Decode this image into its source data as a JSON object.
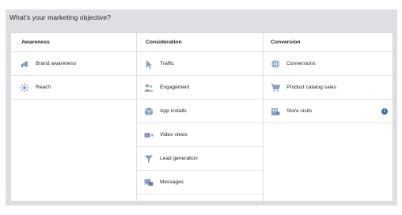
{
  "title": "What's your marketing objective?",
  "columns": [
    {
      "header": "Awareness",
      "items": [
        {
          "label": "Brand awareness",
          "icon": "megaphone-icon"
        },
        {
          "label": "Reach",
          "icon": "reach-icon"
        }
      ]
    },
    {
      "header": "Consideration",
      "items": [
        {
          "label": "Traffic",
          "icon": "cursor-icon"
        },
        {
          "label": "Engagement",
          "icon": "people-icon"
        },
        {
          "label": "App installs",
          "icon": "cube-icon"
        },
        {
          "label": "Video views",
          "icon": "video-icon"
        },
        {
          "label": "Lead generation",
          "icon": "funnel-icon"
        },
        {
          "label": "Messages",
          "icon": "chat-icon"
        }
      ]
    },
    {
      "header": "Conversion",
      "items": [
        {
          "label": "Conversions",
          "icon": "globe-icon"
        },
        {
          "label": "Product catalog sales",
          "icon": "cart-icon"
        },
        {
          "label": "Store visits",
          "icon": "store-icon",
          "info": "i"
        }
      ]
    }
  ],
  "colors": {
    "icon_blue": "#8b9dc3",
    "accent": "#4267b2",
    "panel_bg": "#dddfe2"
  }
}
